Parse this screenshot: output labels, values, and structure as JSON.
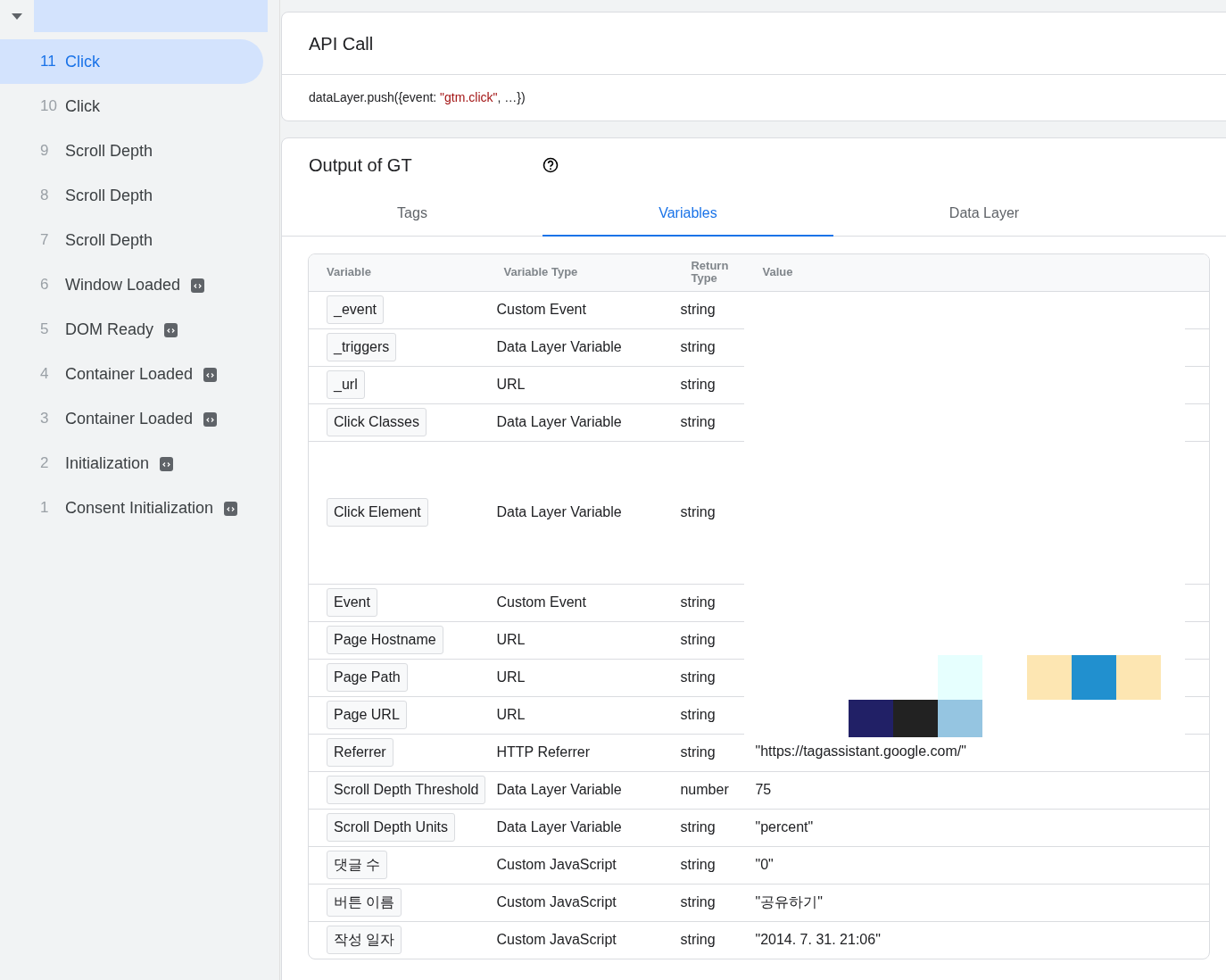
{
  "sidebar": {
    "items": [
      {
        "number": "11",
        "label": "Click",
        "selected": true,
        "badge": false
      },
      {
        "number": "10",
        "label": "Click",
        "selected": false,
        "badge": false
      },
      {
        "number": "9",
        "label": "Scroll Depth",
        "selected": false,
        "badge": false
      },
      {
        "number": "8",
        "label": "Scroll Depth",
        "selected": false,
        "badge": false
      },
      {
        "number": "7",
        "label": "Scroll Depth",
        "selected": false,
        "badge": false
      },
      {
        "number": "6",
        "label": "Window Loaded",
        "selected": false,
        "badge": true
      },
      {
        "number": "5",
        "label": "DOM Ready",
        "selected": false,
        "badge": true
      },
      {
        "number": "4",
        "label": "Container Loaded",
        "selected": false,
        "badge": true
      },
      {
        "number": "3",
        "label": "Container Loaded",
        "selected": false,
        "badge": true
      },
      {
        "number": "2",
        "label": "Initialization",
        "selected": false,
        "badge": true
      },
      {
        "number": "1",
        "label": "Consent Initialization",
        "selected": false,
        "badge": true
      }
    ]
  },
  "api_call": {
    "title": "API Call",
    "code": [
      {
        "kind": "plain",
        "text": "dataLayer.push({event: "
      },
      {
        "kind": "string",
        "text": "\"gtm.click\""
      },
      {
        "kind": "plain",
        "text": ", …})"
      }
    ]
  },
  "output": {
    "title": "Output of GT",
    "tabs": [
      {
        "label": "Tags",
        "selected": false
      },
      {
        "label": "Variables",
        "selected": true
      },
      {
        "label": "Data Layer",
        "selected": false
      }
    ],
    "table": {
      "columns": [
        "Variable",
        "Variable Type",
        "Return Type",
        "Value"
      ],
      "rows": [
        {
          "variable": "_event",
          "type": "Custom Event",
          "return_type": "string"
        },
        {
          "variable": "_triggers",
          "type": "Data Layer Variable",
          "return_type": "string"
        },
        {
          "variable": "_url",
          "type": "URL",
          "return_type": "string"
        },
        {
          "variable": "Click Classes",
          "type": "Data Layer Variable",
          "return_type": "string"
        },
        {
          "variable": "Click Element",
          "type": "Data Layer Variable",
          "return_type": "string"
        },
        {
          "variable": "Event",
          "type": "Custom Event",
          "return_type": "string"
        },
        {
          "variable": "Page Hostname",
          "type": "URL",
          "return_type": "string"
        },
        {
          "variable": "Page Path",
          "type": "URL",
          "return_type": "string"
        },
        {
          "variable": "Page URL",
          "type": "URL",
          "return_type": "string"
        },
        {
          "variable": "Referrer",
          "type": "HTTP Referrer",
          "return_type": "string",
          "value": "\"https://tagassistant.google.com/\""
        },
        {
          "variable": "Scroll Depth Threshold",
          "type": "Data Layer Variable",
          "return_type": "number",
          "value": "75"
        },
        {
          "variable": "Scroll Depth Units",
          "type": "Data Layer Variable",
          "return_type": "string",
          "value": "\"percent\""
        },
        {
          "variable": "댓글 수",
          "type": "Custom JavaScript",
          "return_type": "string",
          "value": "\"0\""
        },
        {
          "variable": "버튼 이름",
          "type": "Custom JavaScript",
          "return_type": "string",
          "value": "\"공유하기\""
        },
        {
          "variable": "작성 일자",
          "type": "Custom JavaScript",
          "return_type": "string",
          "value": "\"2014. 7. 31. 21:06\""
        }
      ]
    }
  }
}
